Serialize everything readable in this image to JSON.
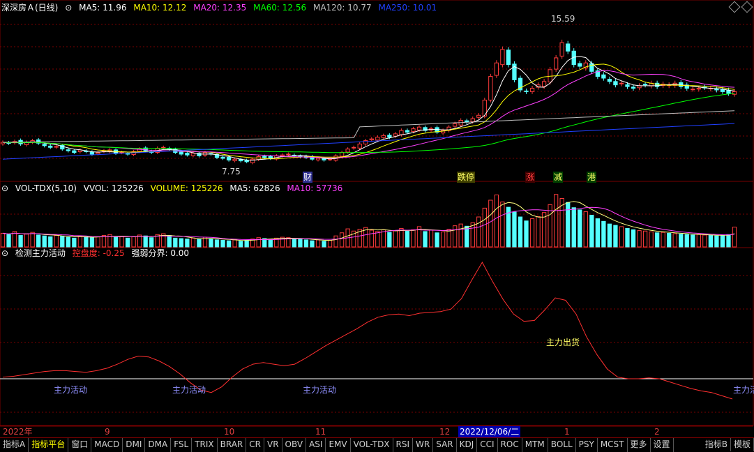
{
  "colors": {
    "up": "#ff3c3c",
    "down": "#54ffff",
    "ma5": "#ffffff",
    "ma10": "#ffff00",
    "ma20": "#ff40ff",
    "ma60": "#00ff00",
    "ma120": "#c0c0c0",
    "ma250": "#2040ff",
    "grid": "#7a0000",
    "signal": "#ff3030"
  },
  "header": {
    "stock": "深深房Ａ(日线)",
    "ma5": "MA5: 11.96",
    "ma10": "MA10: 12.12",
    "ma20": "MA20: 12.35",
    "ma60": "MA60: 12.56",
    "ma120": "MA120: 10.77",
    "ma250": "MA250: 10.01"
  },
  "price_labels": {
    "high": "15.59",
    "low": "7.75"
  },
  "events": [
    "财",
    "跌停",
    "涨",
    "减",
    "港"
  ],
  "volume_header": {
    "name": "VOL-TDX(5,10)",
    "vvol": "VVOL: 125226",
    "volume": "VOLUME: 125226",
    "ma5": "MA5: 62826",
    "ma10": "MA10: 57736"
  },
  "indicator_header": {
    "name": "检测主力活动",
    "control": "控盘度: -0.25",
    "boundary": "强弱分界: 0.00"
  },
  "indicator_labels": [
    "主力活动",
    "主力活动",
    "主力活动",
    "主力出货",
    "主力活"
  ],
  "axis": {
    "year": "2022年",
    "months": [
      "9",
      "10",
      "11",
      "12",
      "1",
      "2"
    ],
    "selected_date": "2022/12/06/二"
  },
  "tabs": [
    "指标A",
    "指标平台",
    "窗口",
    "MACD",
    "DMI",
    "DMA",
    "FSL",
    "TRIX",
    "BRAR",
    "CR",
    "VR",
    "OBV",
    "ASI",
    "EMV",
    "VOL-TDX",
    "RSI",
    "WR",
    "SAR",
    "KDJ",
    "CCI",
    "ROC",
    "MTM",
    "BOLL",
    "PSY",
    "MCST",
    "更多",
    "设置"
  ],
  "tabs_right": [
    "指标B",
    "模板"
  ],
  "chart_data": {
    "type": "candlestick",
    "note_ranges": {
      "price_ylim": [
        7.0,
        16.5
      ]
    },
    "close": [
      8.9,
      8.85,
      8.95,
      8.8,
      8.9,
      9.0,
      8.85,
      8.7,
      8.6,
      8.65,
      8.5,
      8.4,
      8.3,
      8.45,
      8.35,
      8.2,
      8.3,
      8.4,
      8.45,
      8.25,
      8.3,
      8.2,
      8.35,
      8.5,
      8.4,
      8.3,
      8.55,
      8.6,
      8.5,
      8.3,
      8.2,
      8.15,
      8.25,
      8.1,
      8.3,
      8.2,
      8.0,
      7.95,
      7.85,
      7.9,
      7.8,
      7.75,
      7.9,
      8.05,
      8.0,
      7.95,
      8.1,
      8.15,
      8.2,
      8.1,
      8.05,
      8.0,
      7.9,
      7.95,
      7.85,
      7.9,
      8.1,
      8.3,
      8.5,
      8.6,
      8.8,
      9.0,
      9.1,
      9.2,
      9.3,
      9.2,
      9.4,
      9.6,
      9.5,
      9.7,
      9.8,
      9.6,
      9.7,
      9.5,
      9.6,
      9.8,
      10.0,
      10.2,
      10.1,
      10.3,
      10.5,
      11.4,
      12.8,
      13.6,
      14.4,
      13.5,
      12.6,
      12.0,
      11.9,
      12.1,
      12.3,
      12.5,
      13.2,
      13.9,
      14.8,
      14.3,
      13.5,
      13.4,
      13.6,
      13.1,
      12.8,
      12.7,
      12.5,
      12.3,
      12.4,
      12.2,
      12.1,
      12.25,
      12.3,
      12.4,
      12.2,
      12.35,
      12.3,
      12.4,
      12.2,
      12.1,
      12.05,
      12.1,
      12.15,
      12.1,
      12.0,
      11.9,
      11.8,
      11.9
    ],
    "volume": [
      3.1,
      2.8,
      3.5,
      2.6,
      2.9,
      3.3,
      2.7,
      2.5,
      2.3,
      2.6,
      2.4,
      2.2,
      2.0,
      2.5,
      2.3,
      2.1,
      2.3,
      2.6,
      2.8,
      2.2,
      2.4,
      2.0,
      2.3,
      2.7,
      2.5,
      2.1,
      2.8,
      3.0,
      2.6,
      2.0,
      1.9,
      1.8,
      2.0,
      1.7,
      2.2,
      1.9,
      1.6,
      1.5,
      1.4,
      1.6,
      1.3,
      1.5,
      1.8,
      2.1,
      1.9,
      1.7,
      2.0,
      2.2,
      2.1,
      1.8,
      1.7,
      1.6,
      1.4,
      1.6,
      1.3,
      1.5,
      2.5,
      3.2,
      4.1,
      3.6,
      4.0,
      4.4,
      3.8,
      3.5,
      3.9,
      3.3,
      3.7,
      4.2,
      3.6,
      3.9,
      4.6,
      3.5,
      3.8,
      3.2,
      3.4,
      4.0,
      4.8,
      5.2,
      4.7,
      5.5,
      6.8,
      8.8,
      10.6,
      11.8,
      10.2,
      9.0,
      7.9,
      6.8,
      5.9,
      6.4,
      6.9,
      7.8,
      9.6,
      11.9,
      11.0,
      10.1,
      8.9,
      8.4,
      8.0,
      7.2,
      6.4,
      5.8,
      5.2,
      4.9,
      4.6,
      4.2,
      3.9,
      3.7,
      3.6,
      3.4,
      3.2,
      3.3,
      3.1,
      3.0,
      2.9,
      2.8,
      2.7,
      2.8,
      2.7,
      2.6,
      2.5,
      2.6,
      2.8,
      4.5
    ],
    "control_series": [
      0.02,
      0.03,
      0.05,
      0.07,
      0.09,
      0.1,
      0.1,
      0.09,
      0.08,
      0.1,
      0.13,
      0.18,
      0.24,
      0.28,
      0.27,
      0.22,
      0.15,
      0.06,
      -0.05,
      -0.14,
      -0.17,
      -0.1,
      0.02,
      0.12,
      0.18,
      0.2,
      0.18,
      0.16,
      0.18,
      0.25,
      0.33,
      0.41,
      0.48,
      0.55,
      0.62,
      0.7,
      0.76,
      0.79,
      0.8,
      0.78,
      0.81,
      0.82,
      0.83,
      0.86,
      0.99,
      1.22,
      1.44,
      1.2,
      0.98,
      0.8,
      0.71,
      0.72,
      0.85,
      1.0,
      0.97,
      0.8,
      0.52,
      0.3,
      0.12,
      0.02,
      0.0,
      0.0,
      0.01,
      0.0,
      -0.04,
      -0.08,
      -0.12,
      -0.15,
      -0.17,
      -0.21,
      -0.25
    ],
    "boundary": 0.0
  }
}
